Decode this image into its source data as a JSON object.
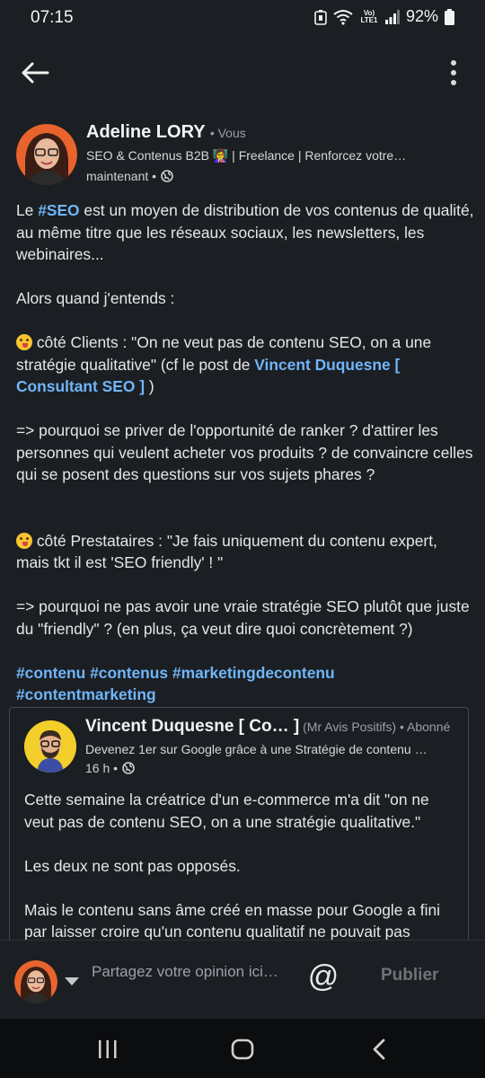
{
  "status": {
    "time": "07:15",
    "lte": "Vo) LTE1",
    "battery": "92%"
  },
  "appbar": {
    "back_icon": "arrow-left-icon",
    "more_icon": "more-vertical-icon"
  },
  "post": {
    "author_name": "Adeline LORY",
    "author_badge": "• Vous",
    "author_headline": "SEO & Contenus B2B 👩‍🏫 | Freelance | Renforcez votre…",
    "time": "maintenant •",
    "body": {
      "p1_pre": "Le ",
      "p1_tag": "#SEO",
      "p1_post": " est un moyen de distribution de vos contenus de qualité, au même titre que les réseaux sociaux, les newsletters, les webinaires...",
      "p2": "Alors quand j'entends :",
      "p3_pre": " côté Clients : \"On ne veut pas de contenu SEO, on a une stratégie qualitative\" (cf le post de ",
      "p3_mention": "Vincent Duquesne [ Consultant SEO ]",
      "p3_post": " )",
      "p4": "=> pourquoi se priver de l'opportunité de ranker ? d'attirer les personnes qui veulent acheter vos produits ? de convaincre celles qui se posent des questions sur vos sujets phares ?",
      "p5": " côté Prestataires : \"Je fais uniquement du contenu expert, mais tkt il est 'SEO friendly' ! \"",
      "p6": "=> pourquoi ne pas avoir une vraie stratégie SEO plutôt que juste du \"friendly\" ? (en plus, ça veut dire quoi concrètement ?)",
      "hashtags": "#contenu #contenus #marketingdecontenu #contentmarketing"
    }
  },
  "shared": {
    "author_name": "Vincent Duquesne [ Co… ]",
    "author_extra": " (Mr Avis Positifs) • Abonné",
    "author_headline": "Devenez 1er sur Google grâce à une Stratégie de contenu …",
    "time": "16 h •",
    "p1": "Cette semaine la créatrice d'un e-commerce m'a dit \"on ne veut pas de contenu SEO, on a une stratégie qualitative.\"",
    "p2": "Les deux ne sont pas opposés.",
    "p3": "Mais le contenu sans âme créé en masse pour Google a fini par laisser croire qu'un contenu qualitatif ne pouvait pas"
  },
  "comment": {
    "placeholder": "Partagez votre opinion ici…",
    "at_symbol": "@",
    "publish_label": "Publier"
  },
  "colors": {
    "link": "#70b5f9",
    "background": "#1b1f23",
    "navbar": "#0c0d0f"
  }
}
